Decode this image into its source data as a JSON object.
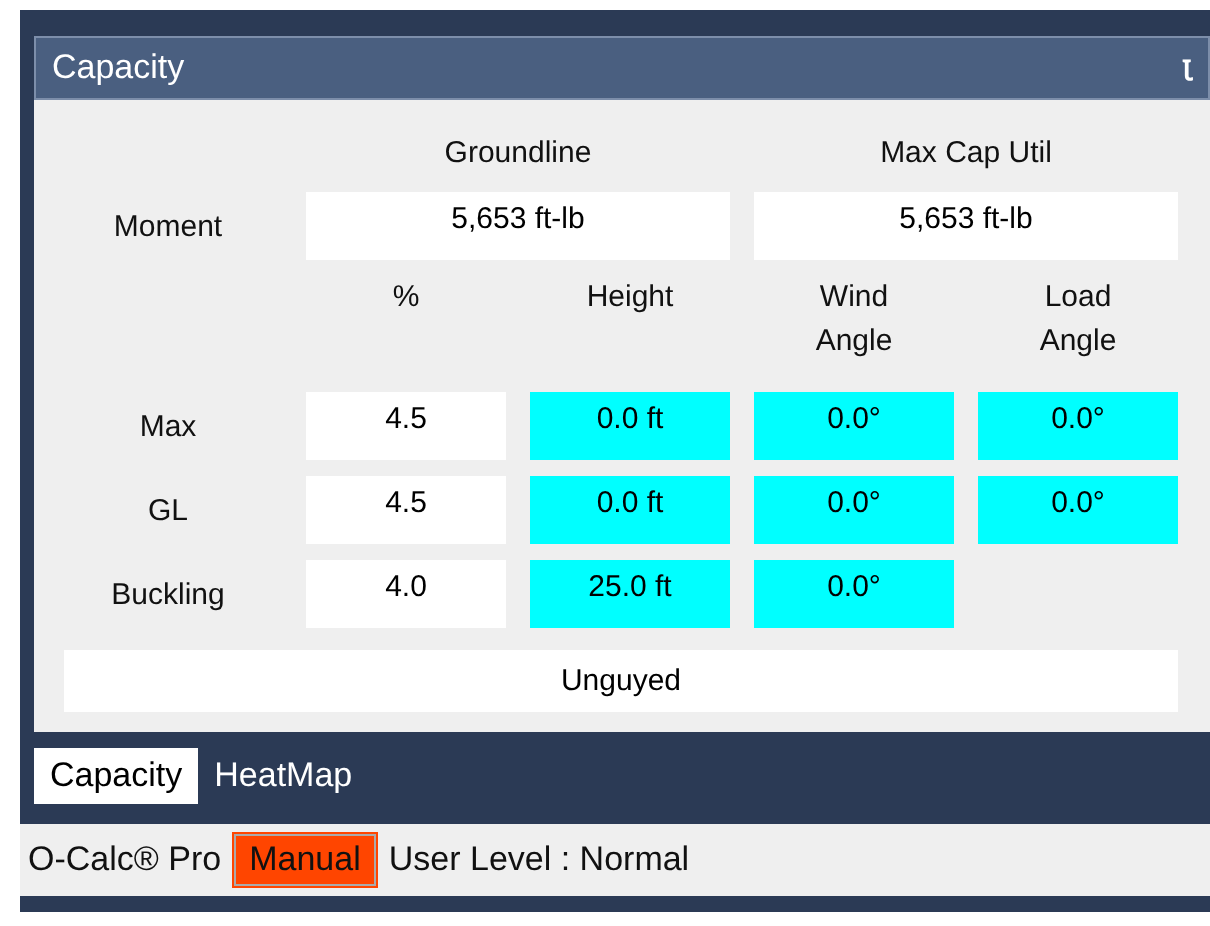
{
  "panel": {
    "title": "Capacity",
    "pin": "Ꙇ"
  },
  "moment": {
    "label": "Moment",
    "columns": [
      "Groundline",
      "Max Cap Util"
    ],
    "values": [
      "5,653 ft-lb",
      "5,653 ft-lb"
    ]
  },
  "columns": [
    "%",
    "Height",
    "Wind\nAngle",
    "Load\nAngle"
  ],
  "rows": [
    {
      "label": "Max",
      "cells": [
        {
          "text": "4.5",
          "highlighted": false
        },
        {
          "text": "0.0 ft",
          "highlighted": true
        },
        {
          "text": "0.0°",
          "highlighted": true
        },
        {
          "text": "0.0°",
          "highlighted": true
        }
      ]
    },
    {
      "label": "GL",
      "cells": [
        {
          "text": "4.5",
          "highlighted": false
        },
        {
          "text": "0.0 ft",
          "highlighted": true
        },
        {
          "text": "0.0°",
          "highlighted": true
        },
        {
          "text": "0.0°",
          "highlighted": true
        }
      ]
    },
    {
      "label": "Buckling",
      "cells": [
        {
          "text": "4.0",
          "highlighted": false
        },
        {
          "text": "25.0 ft",
          "highlighted": true
        },
        {
          "text": "0.0°",
          "highlighted": true
        }
      ]
    }
  ],
  "guy_status": "Unguyed",
  "tabs": [
    {
      "label": "Capacity",
      "selected": true
    },
    {
      "label": "HeatMap",
      "selected": false
    }
  ],
  "status_bar": {
    "product": "O-Calc® Pro",
    "mode": "Manual",
    "user_level": "User Level : Normal"
  }
}
